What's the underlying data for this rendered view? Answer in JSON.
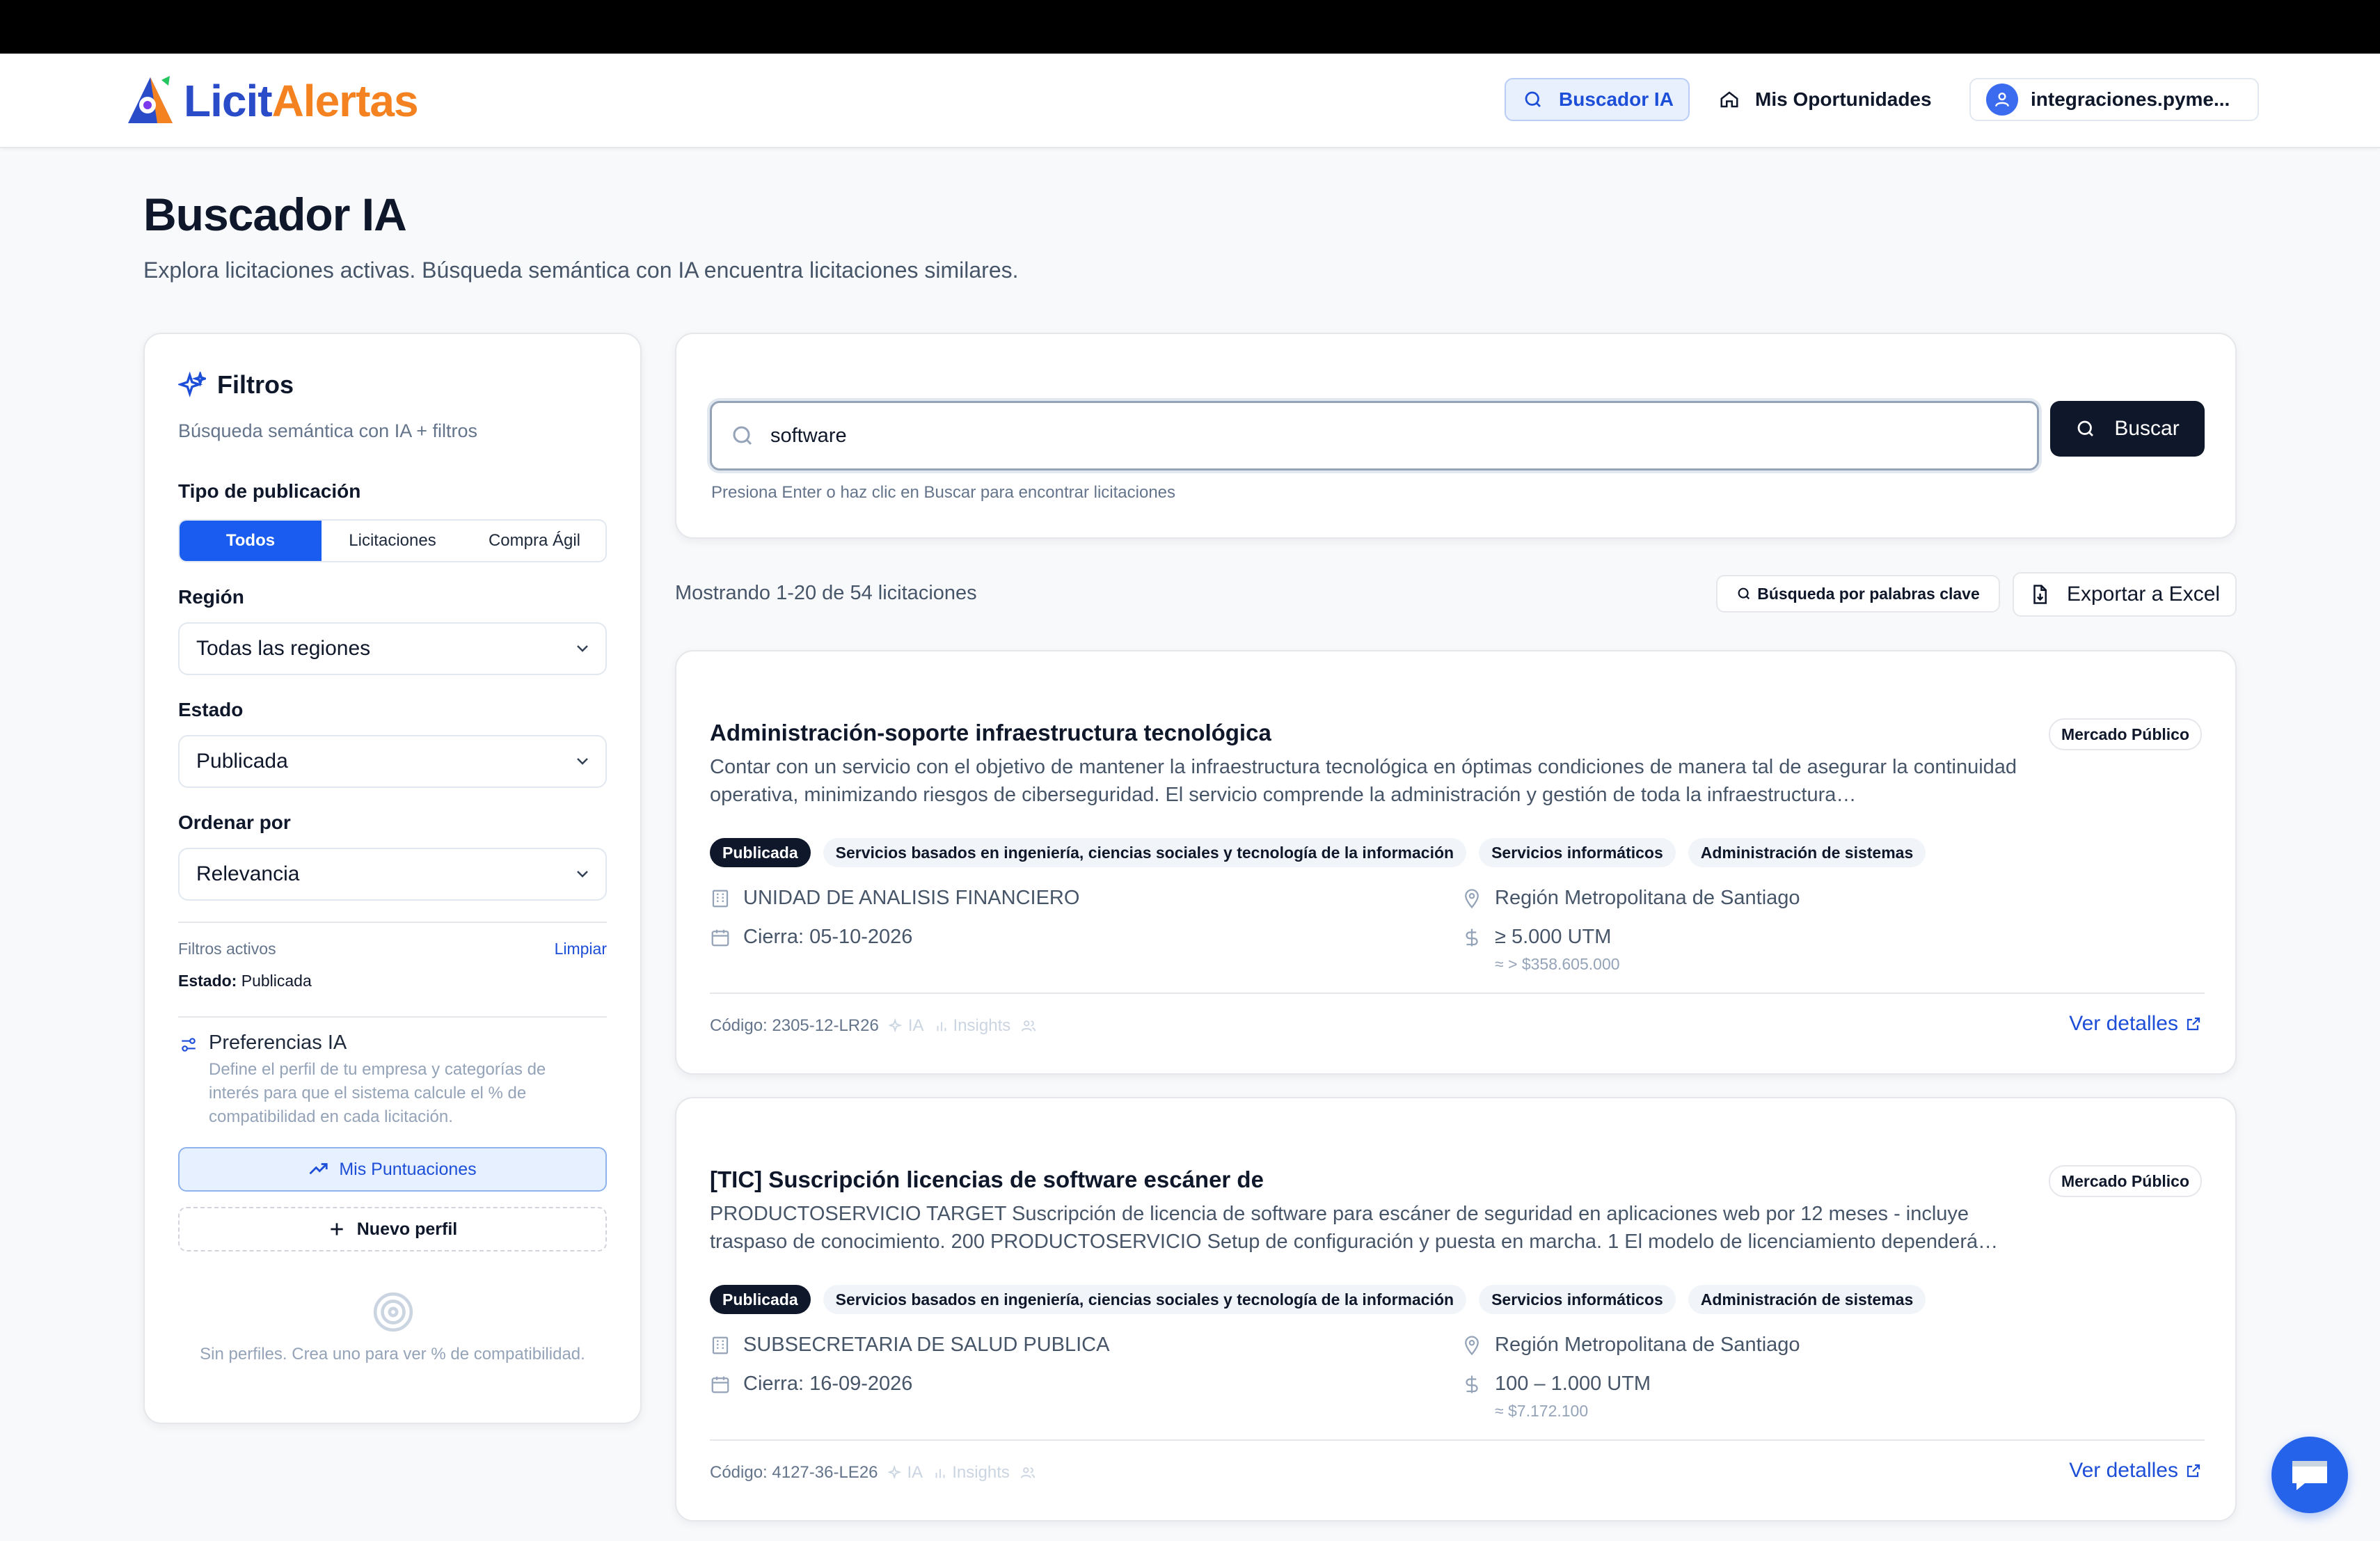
{
  "brand": {
    "part1": "Licit",
    "part2": "Alertas",
    "licit_color": "#2b4cc9",
    "alertas_color": "#f58220"
  },
  "nav": {
    "buscador": "Buscador IA",
    "oportunidades": "Mis Oportunidades",
    "user": "integraciones.pyme..."
  },
  "page": {
    "title": "Buscador IA",
    "subtitle": "Explora licitaciones activas. Búsqueda semántica con IA encuentra licitaciones similares."
  },
  "filters": {
    "title": "Filtros",
    "subtitle": "Búsqueda semántica con IA + filtros",
    "tipo_label": "Tipo de publicación",
    "tipo_options": [
      "Todos",
      "Licitaciones",
      "Compra Ágil"
    ],
    "tipo_selected": "Todos",
    "region_label": "Región",
    "region_value": "Todas las regiones",
    "estado_label": "Estado",
    "estado_value": "Publicada",
    "orden_label": "Ordenar por",
    "orden_value": "Relevancia",
    "activos_label": "Filtros activos",
    "limpiar": "Limpiar",
    "activo_key": "Estado:",
    "activo_val": "Publicada",
    "pref_title": "Preferencias IA",
    "pref_desc": "Define el perfil de tu empresa y categorías de interés para que el sistema calcule el % de compatibilidad en cada licitación.",
    "puntuaciones": "Mis Puntuaciones",
    "nuevo_perfil": "Nuevo perfil",
    "empty_text": "Sin perfiles. Crea uno para ver % de compatibilidad."
  },
  "search": {
    "value": "software",
    "button": "Buscar",
    "hint": "Presiona Enter o haz clic en Buscar para encontrar licitaciones"
  },
  "results_bar": {
    "count": "Mostrando 1-20 de 54 licitaciones",
    "keyword_btn": "Búsqueda por palabras clave",
    "export_btn": "Exportar a Excel"
  },
  "results": [
    {
      "title": "Administración-soporte infraestructura tecnológica",
      "source": "Mercado Público",
      "desc": "Contar con un servicio con el objetivo de mantener la infraestructura tecnológica en óptimas condiciones de manera tal de asegurar la continuidad operativa, minimizando riesgos de ciberseguridad. El servicio comprende la administración y gestión de toda la infraestructura…",
      "tags": [
        "Publicada",
        "Servicios basados en ingeniería, ciencias sociales y tecnología de la información",
        "Servicios informáticos",
        "Administración de sistemas"
      ],
      "org": "UNIDAD DE ANALISIS FINANCIERO",
      "close": "Cierra: 05-10-2026",
      "region": "Región Metropolitana de Santiago",
      "amount": "≥ 5.000 UTM",
      "amount_clp": "≈ > $358.605.000",
      "code": "Código: 2305-12-LR26",
      "ia": "IA",
      "insights": "Insights",
      "link": "Ver detalles"
    },
    {
      "title": "[TIC] Suscripción licencias de software escáner de",
      "source": "Mercado Público",
      "desc": "PRODUCTOSERVICIO TARGET Suscripción de licencia de software para escáner de seguridad en aplicaciones web por 12 meses - incluye traspaso de conocimiento. 200 PRODUCTOSERVICIO Setup de configuración y puesta en marcha. 1 El modelo de licenciamiento dependerá…",
      "tags": [
        "Publicada",
        "Servicios basados en ingeniería, ciencias sociales y tecnología de la información",
        "Servicios informáticos",
        "Administración de sistemas"
      ],
      "org": "SUBSECRETARIA DE SALUD PUBLICA",
      "close": "Cierra: 16-09-2026",
      "region": "Región Metropolitana de Santiago",
      "amount": "100 – 1.000 UTM",
      "amount_clp": "≈ $7.172.100",
      "code": "Código: 4127-36-LE26",
      "ia": "IA",
      "insights": "Insights",
      "link": "Ver detalles"
    }
  ]
}
